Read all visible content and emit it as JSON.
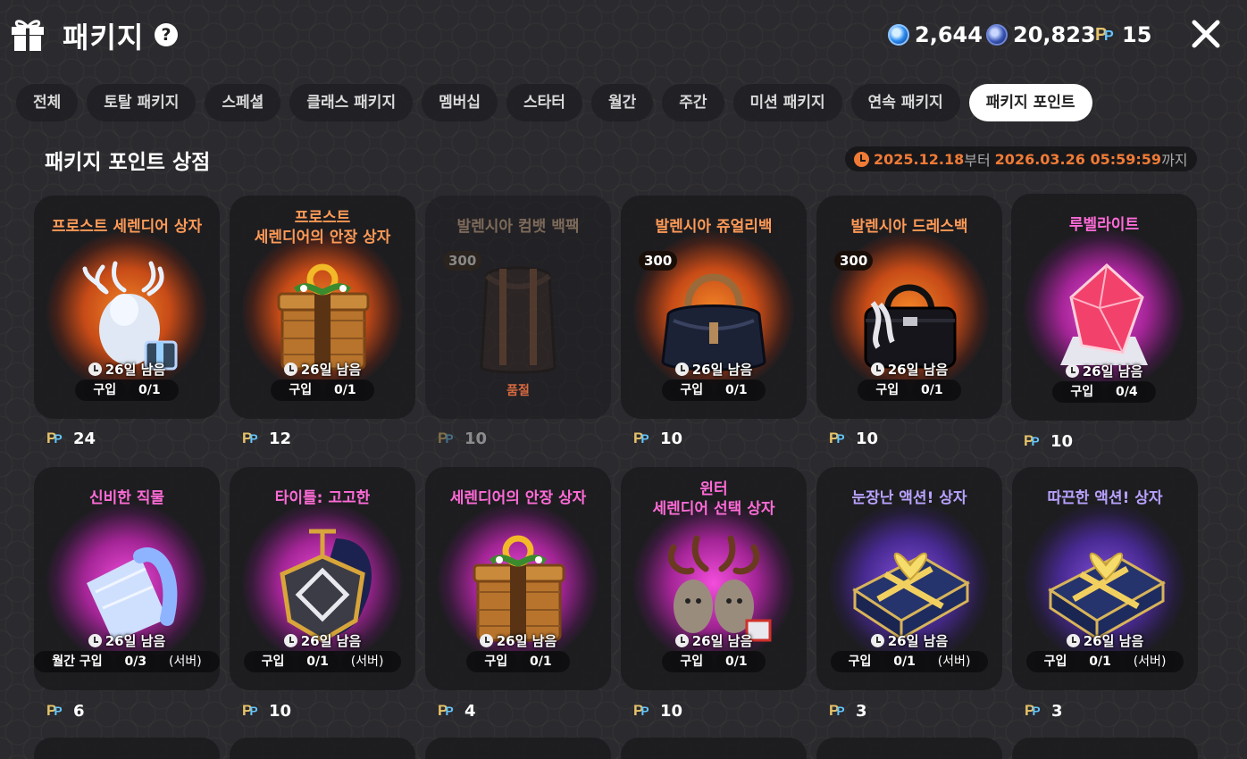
{
  "header": {
    "title": "패키지",
    "help_icon": "help-icon",
    "currencies": [
      {
        "icon": "blue-gem-icon",
        "value": "2,644"
      },
      {
        "icon": "dark-blue-gem-icon",
        "value": "20,823"
      },
      {
        "icon": "package-point-icon",
        "value": "15"
      }
    ]
  },
  "tabs": [
    {
      "label": "전체",
      "active": false
    },
    {
      "label": "토탈 패키지",
      "active": false
    },
    {
      "label": "스페셜",
      "active": false
    },
    {
      "label": "클래스 패키지",
      "active": false
    },
    {
      "label": "멤버십",
      "active": false
    },
    {
      "label": "스타터",
      "active": false
    },
    {
      "label": "월간",
      "active": false
    },
    {
      "label": "주간",
      "active": false
    },
    {
      "label": "미션 패키지",
      "active": false
    },
    {
      "label": "연속 패키지",
      "active": false
    },
    {
      "label": "패키지 포인트",
      "active": true
    }
  ],
  "section": {
    "title": "패키지 포인트 상점",
    "start": "2025.12.18",
    "from": "부터",
    "end": "2026.03.26 05:59:59",
    "until": "까지"
  },
  "colors": {
    "accent_orange": "#f07b36",
    "name_orange": "#ff9a57",
    "name_pink": "#ff6bd7",
    "name_purple": "#b9a2ff",
    "active_tab_bg": "#ffffff"
  },
  "items": [
    {
      "name": "프로스트 세렌디어 상자",
      "remaining": "26일 남음",
      "limit_label": "구입",
      "limit_count": "0/1",
      "limit_suffix": "",
      "price": "24",
      "art": "frost-deer-box-icon"
    },
    {
      "name": "프로스트\n세렌디어의 안장 상자",
      "remaining": "26일 남음",
      "limit_label": "구입",
      "limit_count": "0/1",
      "limit_suffix": "",
      "price": "12",
      "art": "saddle-box-icon"
    },
    {
      "name": "발렌시아 컴뱃 백팩",
      "qty": "300",
      "soldout": "품절",
      "price": "10",
      "art": "backpack-icon"
    },
    {
      "name": "발렌시아 쥬얼리백",
      "qty": "300",
      "remaining": "26일 남음",
      "limit_label": "구입",
      "limit_count": "0/1",
      "limit_suffix": "",
      "price": "10",
      "art": "jewelry-bag-icon"
    },
    {
      "name": "발렌시아 드레스백",
      "qty": "300",
      "remaining": "26일 남음",
      "limit_label": "구입",
      "limit_count": "0/1",
      "limit_suffix": "",
      "price": "10",
      "art": "dress-bag-icon"
    },
    {
      "name": "루벨라이트",
      "remaining": "26일 남음",
      "limit_label": "구입",
      "limit_count": "0/4",
      "limit_suffix": "",
      "price": "10",
      "art": "rubellite-gem-icon"
    },
    {
      "name": "신비한 직물",
      "remaining": "26일 남음",
      "limit_label": "월간 구입",
      "limit_count": "0/3",
      "limit_suffix": "(서버)",
      "price": "6",
      "art": "fabric-roll-icon"
    },
    {
      "name": "타이틀: 고고한",
      "remaining": "26일 남음",
      "limit_label": "구입",
      "limit_count": "0/1",
      "limit_suffix": "(서버)",
      "price": "10",
      "art": "title-emblem-icon"
    },
    {
      "name": "세렌디어의 안장 상자",
      "remaining": "26일 남음",
      "limit_label": "구입",
      "limit_count": "0/1",
      "limit_suffix": "",
      "price": "4",
      "art": "saddle-box-icon"
    },
    {
      "name": "윈터\n세렌디어 선택 상자",
      "remaining": "26일 남음",
      "limit_label": "구입",
      "limit_count": "0/1",
      "limit_suffix": "",
      "price": "10",
      "art": "winter-deer-box-icon"
    },
    {
      "name": "눈장난 액션! 상자",
      "remaining": "26일 남음",
      "limit_label": "구입",
      "limit_count": "0/1",
      "limit_suffix": "(서버)",
      "price": "3",
      "art": "blue-gift-box-icon"
    },
    {
      "name": "따끈한 액션! 상자",
      "remaining": "26일 남음",
      "limit_label": "구입",
      "limit_count": "0/1",
      "limit_suffix": "(서버)",
      "price": "3",
      "art": "blue-gift-box-icon"
    }
  ]
}
